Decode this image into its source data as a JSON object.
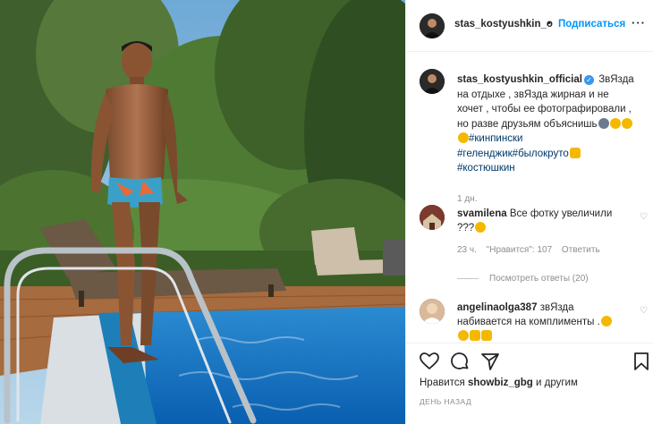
{
  "post": {
    "username": "stas_kostyushkin_o",
    "dot": "•",
    "follow_label": "Подписаться",
    "more_icon": "more-horizontal-icon",
    "more_glyph": "···"
  },
  "caption": {
    "username": "stas_kostyushkin_official",
    "verified_icon": "verified-badge-icon",
    "text": "ЗвЯзда на отдыхе , звЯзда жирная и не хочет , чтобы ее фотографировали , но разве друзьям объяснишь",
    "hashtags": [
      "#кинпински",
      "#геленджик",
      "#былокруто",
      "#костюшкин"
    ],
    "time": "1 дн."
  },
  "comments": [
    {
      "username": "svamilena",
      "text": "Все фотку увеличили ???",
      "time": "23 ч.",
      "likes": "\"Нравится\": 107",
      "reply": "Ответить",
      "view_replies": "Посмотреть ответы (20)"
    },
    {
      "username": "angelinaolga387",
      "text": "звЯзда набивается на комплименты ."
    }
  ],
  "actions": {
    "likes_prefix": "Нравится",
    "likes_user": "showbiz_gbg",
    "likes_suffix": "и другим",
    "date": "ДЕНЬ НАЗАД"
  },
  "colors": {
    "link_blue": "#0095f6",
    "hashtag": "#00376b",
    "muted": "#8e8e8e",
    "text": "#262626"
  }
}
